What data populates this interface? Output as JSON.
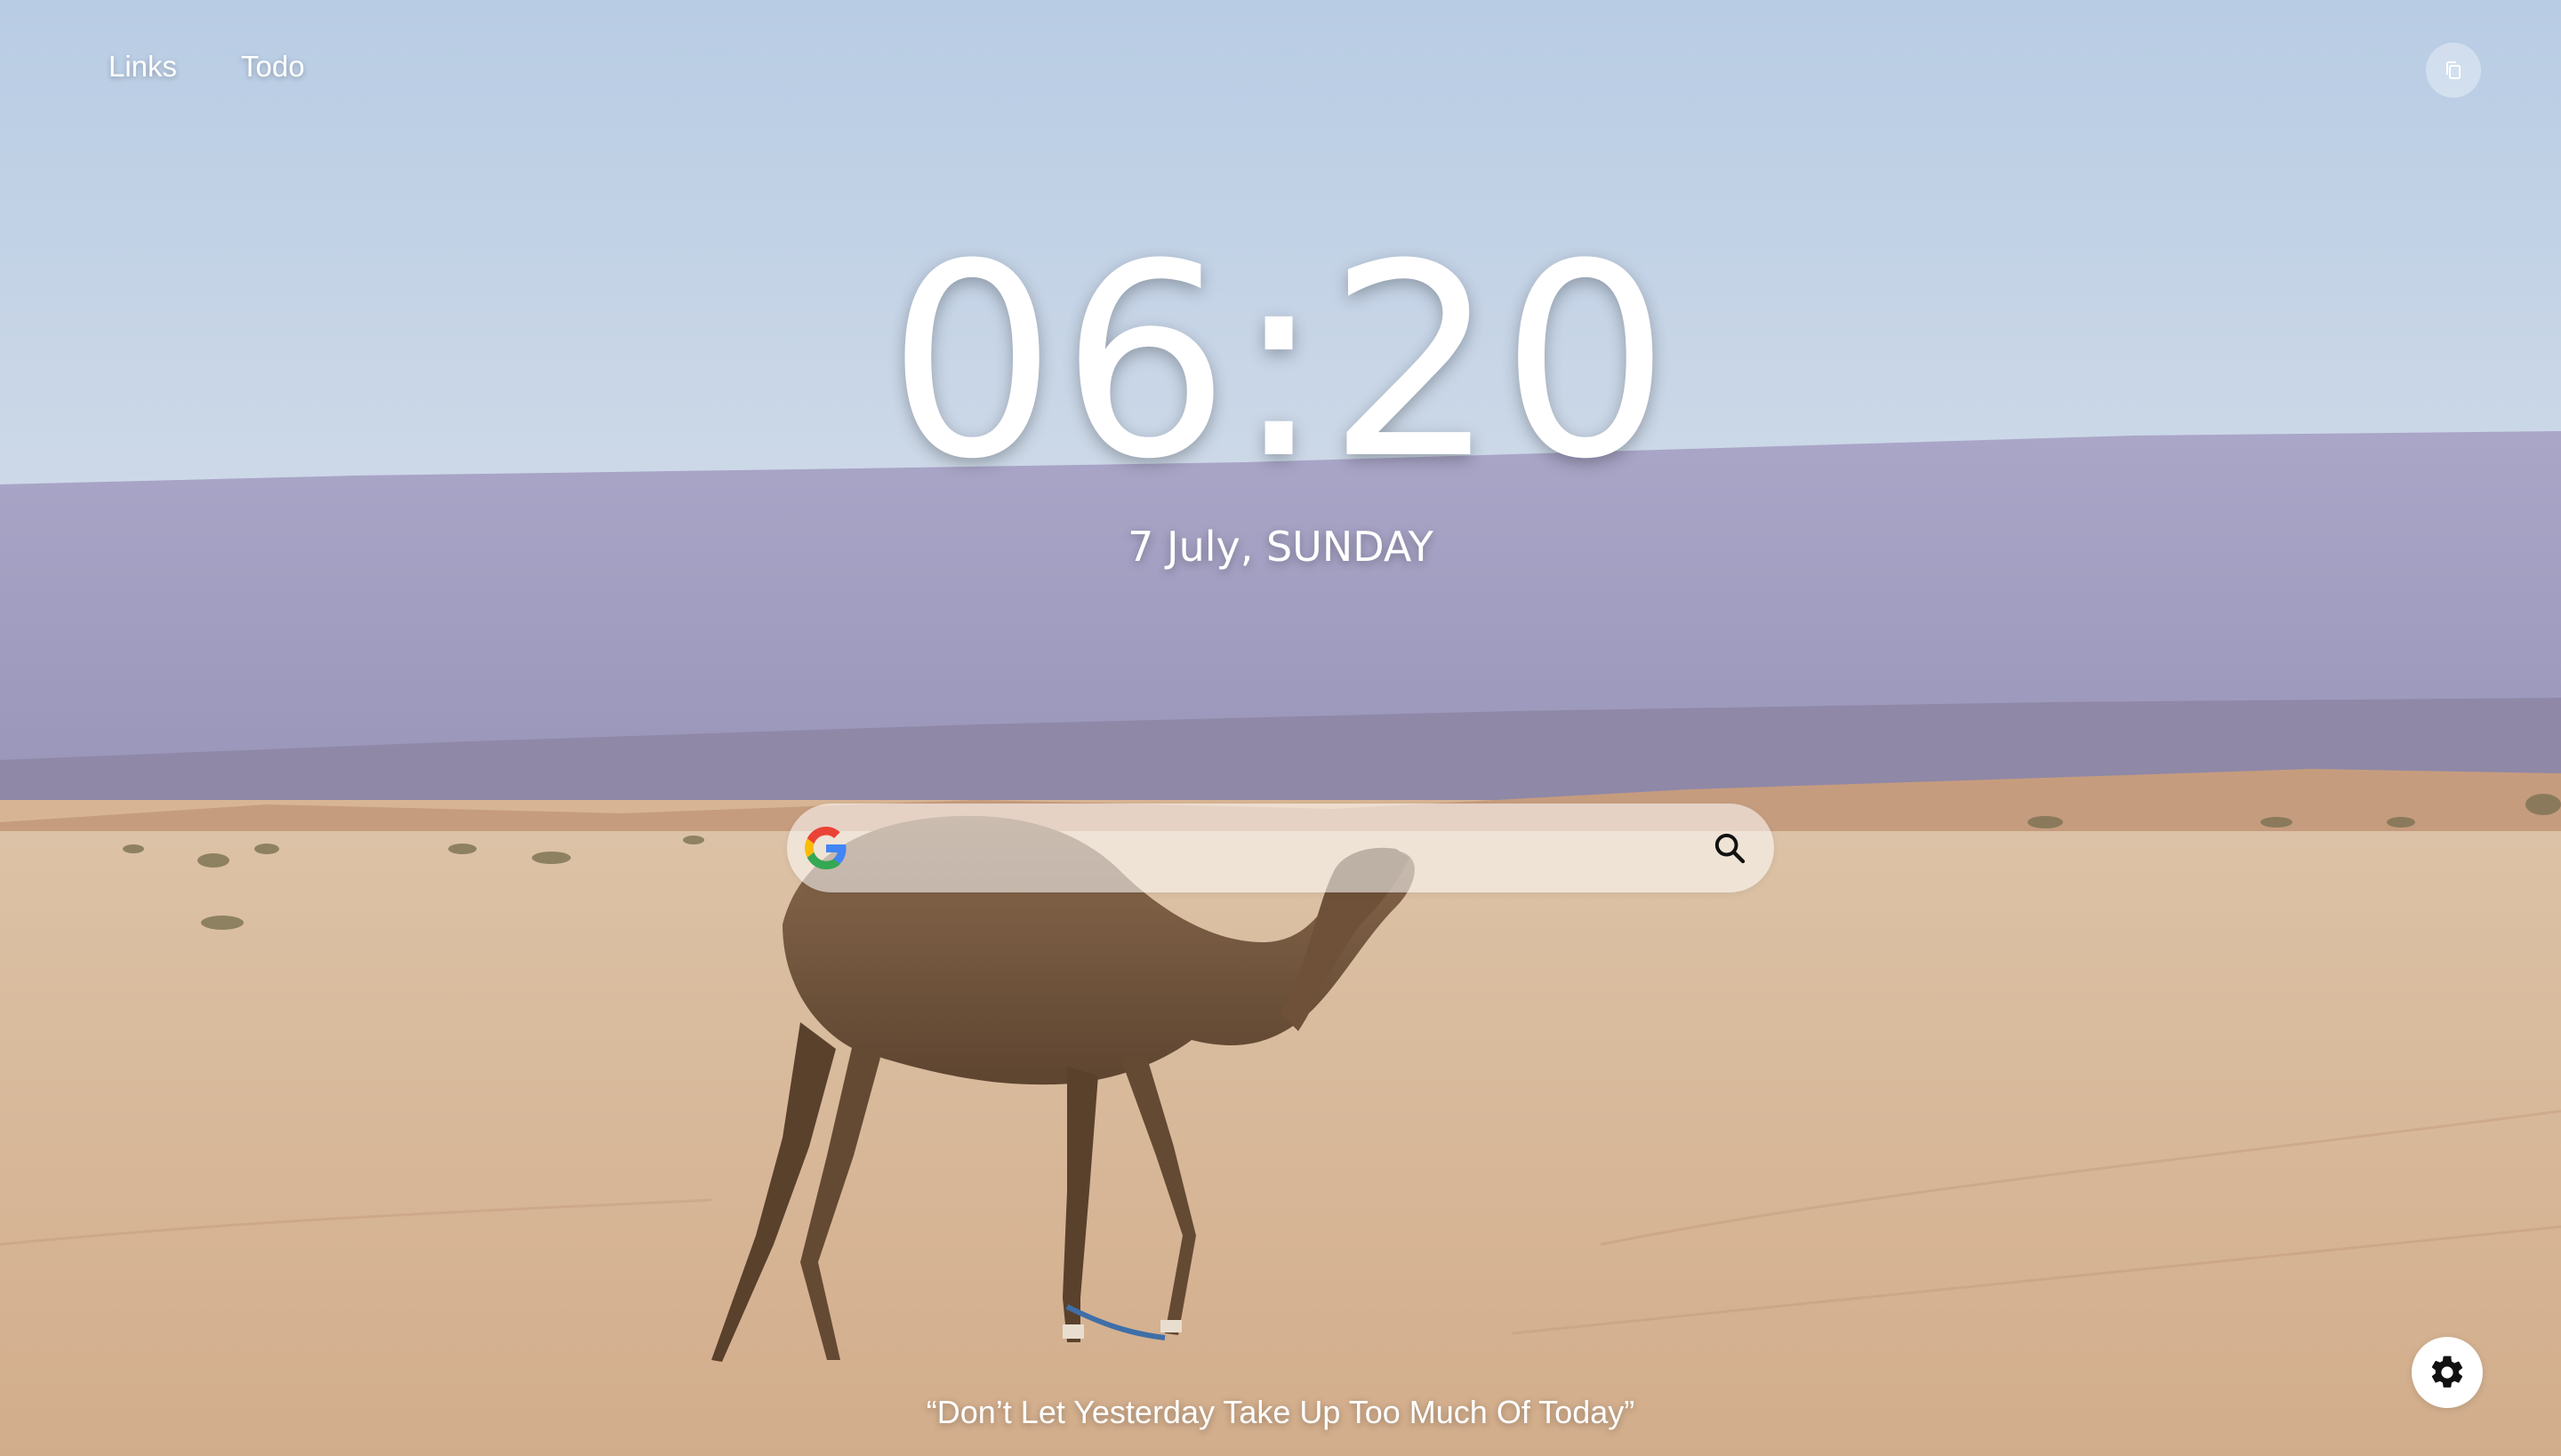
{
  "nav": {
    "links_label": "Links",
    "todo_label": "Todo"
  },
  "clock": {
    "time": "06:20",
    "date": "7 July, SUNDAY"
  },
  "search": {
    "value": "",
    "placeholder": "",
    "engine_icon": "google-icon",
    "submit_icon": "search-icon"
  },
  "quote": {
    "text": "“Don’t Let Yesterday Take Up Too Much Of Today”"
  },
  "icons": {
    "copy": "copy-icon",
    "settings": "gear-icon"
  },
  "colors": {
    "sky": "#c3d3e6",
    "mountains": "#a9a3c6",
    "desert": "#d7b594",
    "text": "#ffffff"
  }
}
